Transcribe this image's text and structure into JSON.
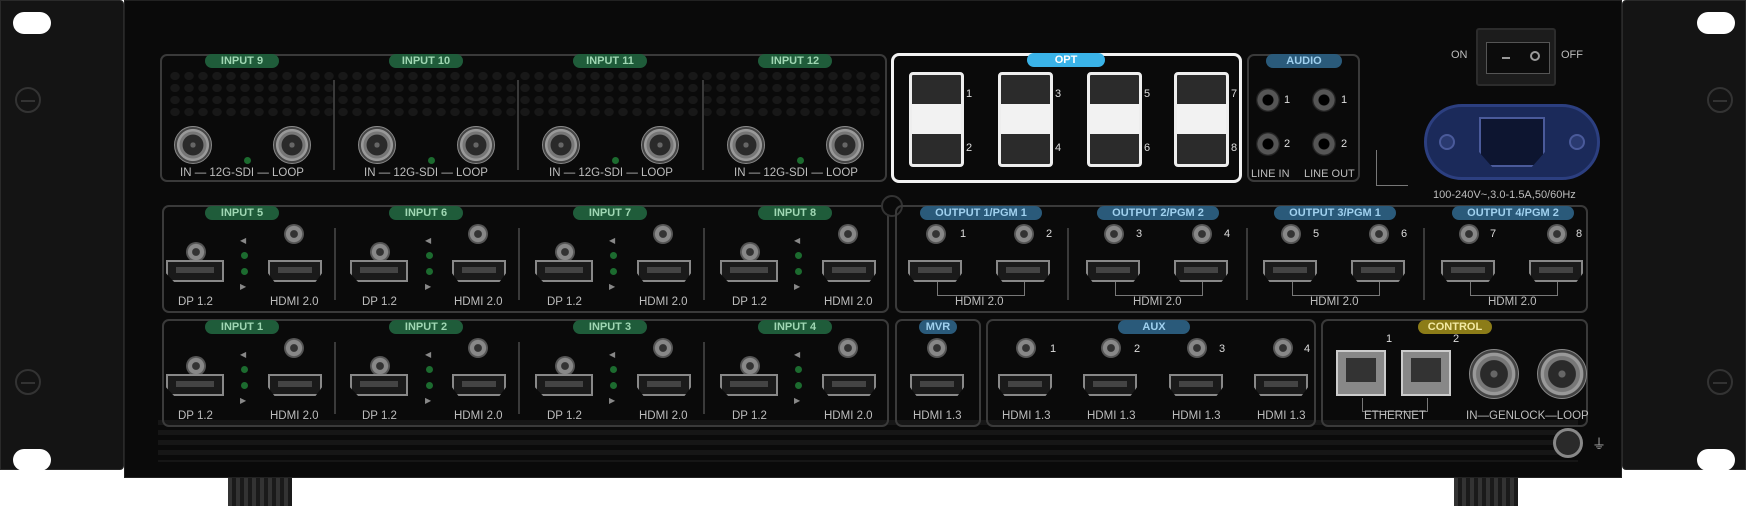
{
  "inputs_top": [
    {
      "label": "INPUT 9",
      "caption": "IN — 12G-SDI — LOOP"
    },
    {
      "label": "INPUT 10",
      "caption": "IN — 12G-SDI — LOOP"
    },
    {
      "label": "INPUT 11",
      "caption": "IN — 12G-SDI — LOOP"
    },
    {
      "label": "INPUT 12",
      "caption": "IN — 12G-SDI — LOOP"
    }
  ],
  "opt": {
    "label": "OPT",
    "ports": [
      "1",
      "2",
      "3",
      "4",
      "5",
      "6",
      "7",
      "8"
    ]
  },
  "audio": {
    "label": "AUDIO",
    "ports": [
      "1",
      "2",
      "1",
      "2"
    ],
    "line_in": "LINE IN",
    "line_out": "LINE OUT"
  },
  "power": {
    "on": "ON",
    "off": "OFF",
    "rating": "100-240V~,3.0-1.5A,50/60Hz"
  },
  "inputs_mid": [
    {
      "label": "INPUT 5",
      "dp": "DP 1.2",
      "hdmi": "HDMI 2.0"
    },
    {
      "label": "INPUT 6",
      "dp": "DP 1.2",
      "hdmi": "HDMI 2.0"
    },
    {
      "label": "INPUT 7",
      "dp": "DP 1.2",
      "hdmi": "HDMI 2.0"
    },
    {
      "label": "INPUT 8",
      "dp": "DP 1.2",
      "hdmi": "HDMI 2.0"
    }
  ],
  "inputs_bot": [
    {
      "label": "INPUT 1",
      "dp": "DP 1.2",
      "hdmi": "HDMI 2.0"
    },
    {
      "label": "INPUT 2",
      "dp": "DP 1.2",
      "hdmi": "HDMI 2.0"
    },
    {
      "label": "INPUT 3",
      "dp": "DP 1.2",
      "hdmi": "HDMI 2.0"
    },
    {
      "label": "INPUT 4",
      "dp": "DP 1.2",
      "hdmi": "HDMI 2.0"
    }
  ],
  "outputs": [
    {
      "label": "OUTPUT 1/PGM 1",
      "ports": [
        "1",
        "2"
      ],
      "hdmi": "HDMI 2.0"
    },
    {
      "label": "OUTPUT 2/PGM 2",
      "ports": [
        "3",
        "4"
      ],
      "hdmi": "HDMI 2.0"
    },
    {
      "label": "OUTPUT 3/PGM 1",
      "ports": [
        "5",
        "6"
      ],
      "hdmi": "HDMI 2.0"
    },
    {
      "label": "OUTPUT 4/PGM 2",
      "ports": [
        "7",
        "8"
      ],
      "hdmi": "HDMI 2.0"
    }
  ],
  "mvr": {
    "label": "MVR",
    "hdmi": "HDMI 1.3"
  },
  "aux": {
    "label": "AUX",
    "ports": [
      "1",
      "2",
      "3",
      "4"
    ],
    "hdmi": [
      "HDMI 1.3",
      "HDMI 1.3",
      "HDMI 1.3",
      "HDMI 1.3"
    ]
  },
  "control": {
    "label": "CONTROL",
    "eth_ports": [
      "1",
      "2"
    ],
    "ethernet": "ETHERNET",
    "genlock": "IN—GENLOCK—LOOP"
  },
  "colors": {
    "input_badge": "#1f5c3a",
    "output_badge": "#2a5a7a",
    "control_badge": "#8c7c18",
    "opt_badge": "#3ab3e8",
    "chassis": "#0a0a0a"
  },
  "icons": {
    "ground": "ground-symbol-icon"
  }
}
